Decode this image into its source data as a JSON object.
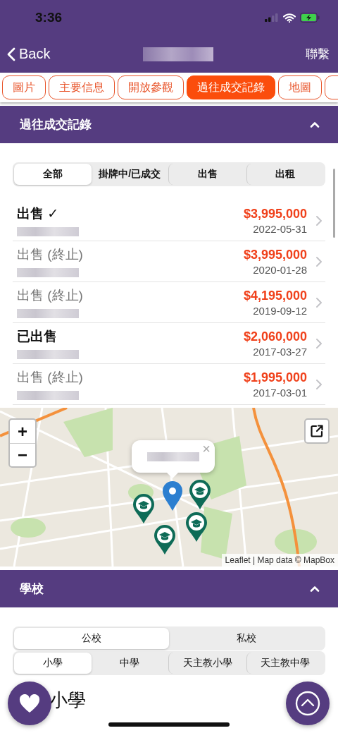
{
  "status_bar": {
    "time": "3:36"
  },
  "nav": {
    "back": "Back",
    "action": "聯繫"
  },
  "section_tabs": [
    {
      "label": "圖片",
      "selected": false
    },
    {
      "label": "主要信息",
      "selected": false
    },
    {
      "label": "開放參觀",
      "selected": false
    },
    {
      "label": "過往成交記錄",
      "selected": true
    },
    {
      "label": "地圖",
      "selected": false
    }
  ],
  "history": {
    "title": "過往成交記錄",
    "expanded": true,
    "filters": [
      {
        "label": "全部",
        "selected": true
      },
      {
        "label": "掛牌中/已成交",
        "selected": false
      },
      {
        "label": "出售",
        "selected": false
      },
      {
        "label": "出租",
        "selected": false
      }
    ],
    "rows": [
      {
        "title": "出售 ✓",
        "emphasized": true,
        "price": "$3,995,000",
        "date": "2022-05-31"
      },
      {
        "title": "出售 (終止)",
        "emphasized": false,
        "price": "$3,995,000",
        "date": "2020-01-28"
      },
      {
        "title": "出售 (終止)",
        "emphasized": false,
        "price": "$4,195,000",
        "date": "2019-09-12"
      },
      {
        "title": "已出售",
        "emphasized": true,
        "price": "$2,060,000",
        "date": "2017-03-27"
      },
      {
        "title": "出售 (終止)",
        "emphasized": false,
        "price": "$1,995,000",
        "date": "2017-03-01"
      }
    ]
  },
  "map": {
    "kind": "picture",
    "popup_close": "×",
    "zoom_in": "+",
    "zoom_out": "−",
    "attribution": "Leaflet | Map data © MapBox"
  },
  "schools": {
    "title": "學校",
    "expanded": true,
    "types": [
      {
        "label": "公校",
        "selected": true
      },
      {
        "label": "私校",
        "selected": false
      }
    ],
    "levels": [
      {
        "label": "小學",
        "selected": true
      },
      {
        "label": "中學",
        "selected": false
      },
      {
        "label": "天主教小學",
        "selected": false
      },
      {
        "label": "天主教中學",
        "selected": false
      }
    ],
    "heading": "小學"
  }
}
